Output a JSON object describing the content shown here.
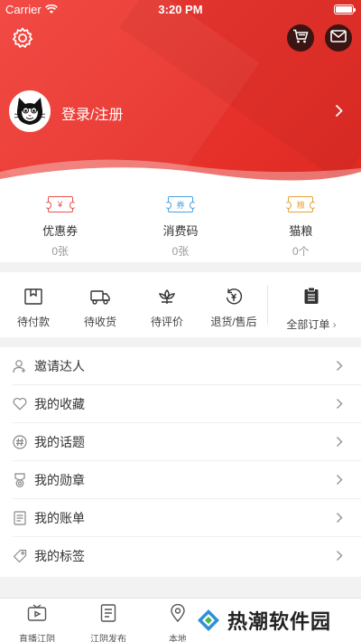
{
  "status_bar": {
    "carrier": "Carrier",
    "time": "3:20 PM"
  },
  "header": {
    "login_label": "登录/注册",
    "icons": [
      "gear-icon",
      "cart-icon",
      "mail-icon"
    ]
  },
  "assets": [
    {
      "name": "优惠券",
      "count": "0张",
      "icon": "¥",
      "color": "#e8524a"
    },
    {
      "name": "消费码",
      "count": "0张",
      "icon": "券",
      "color": "#4aa3df"
    },
    {
      "name": "猫粮",
      "count": "0个",
      "icon": "粮",
      "color": "#e8a33a"
    }
  ],
  "orders": {
    "items": [
      {
        "label": "待付款"
      },
      {
        "label": "待收货"
      },
      {
        "label": "待评价"
      },
      {
        "label": "退货/售后"
      }
    ],
    "all_label": "全部订单"
  },
  "menu": [
    {
      "label": "邀请达人",
      "icon": "user-icon"
    },
    {
      "label": "我的收藏",
      "icon": "heart-icon"
    },
    {
      "label": "我的话题",
      "icon": "hashtag-icon"
    },
    {
      "label": "我的勋章",
      "icon": "medal-icon"
    },
    {
      "label": "我的账单",
      "icon": "bill-icon"
    },
    {
      "label": "我的标签",
      "icon": "tag-icon"
    }
  ],
  "tabbar": [
    {
      "label": "直播江阴",
      "icon": "tv-icon"
    },
    {
      "label": "江阴发布",
      "icon": "document-icon"
    },
    {
      "label": "本地",
      "icon": "location-icon"
    }
  ],
  "watermark": {
    "text": "热潮软件园"
  },
  "colors": {
    "header_red": "#e8322c"
  }
}
